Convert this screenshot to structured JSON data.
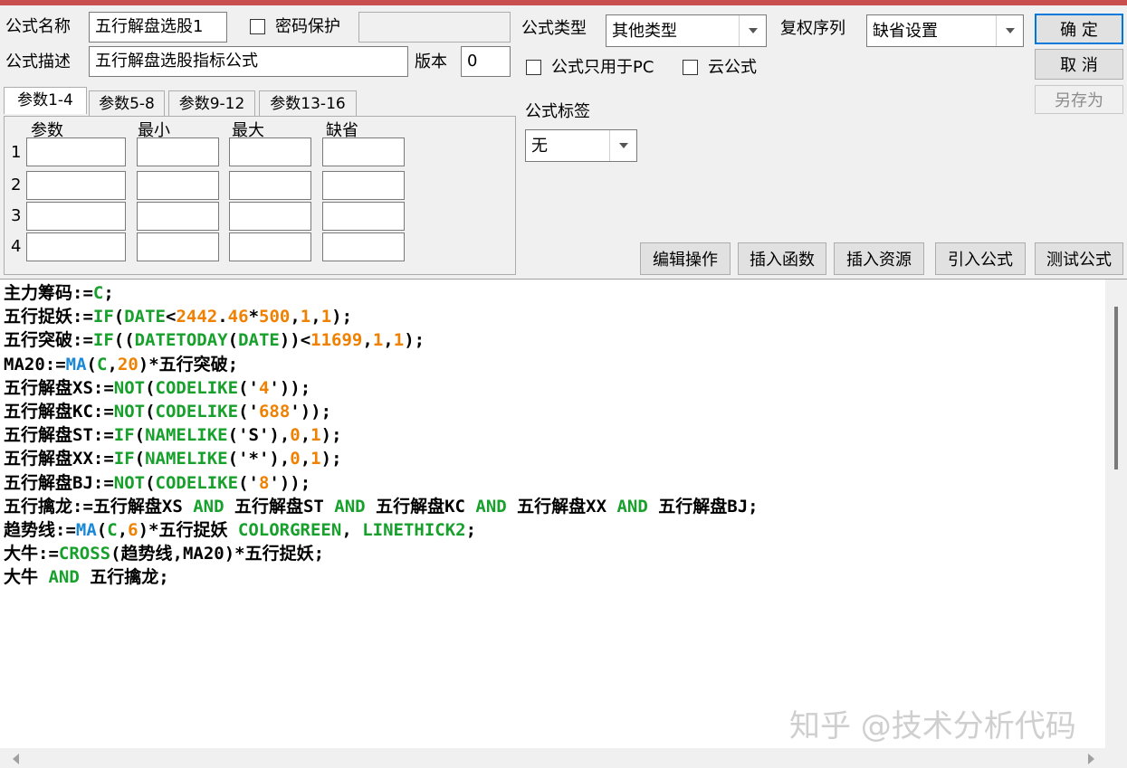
{
  "form": {
    "name_label": "公式名称",
    "name_value": "五行解盘选股1",
    "password_label": "密码保护",
    "password_value": "",
    "desc_label": "公式描述",
    "desc_value": "五行解盘选股指标公式",
    "version_label": "版本",
    "version_value": "0",
    "type_label": "公式类型",
    "type_value": "其他类型",
    "rights_label": "复权序列",
    "rights_value": "缺省设置",
    "pc_only_label": "公式只用于PC",
    "cloud_label": "云公式",
    "tag_label": "公式标签",
    "tag_value": "无"
  },
  "buttons": {
    "ok": "确  定",
    "cancel": "取  消",
    "save_as": "另存为",
    "edit_ops": "编辑操作",
    "insert_func": "插入函数",
    "insert_res": "插入资源",
    "import_formula": "引入公式",
    "test_formula": "测试公式"
  },
  "tabs": [
    "参数1-4",
    "参数5-8",
    "参数9-12",
    "参数13-16"
  ],
  "params": {
    "headers": [
      "参数",
      "最小",
      "最大",
      "缺省"
    ],
    "rows": [
      "1",
      "2",
      "3",
      "4"
    ]
  },
  "colors": {
    "keyword_green": "#18a02c",
    "number_orange": "#f08000",
    "func_blue": "#1a88d8",
    "title_red": "#c94f4f"
  },
  "code_lines": [
    [
      {
        "t": "主力筹码:=",
        "c": "k"
      },
      {
        "t": "C",
        "c": "g"
      },
      {
        "t": ";",
        "c": "k"
      }
    ],
    [
      {
        "t": "五行捉妖:=",
        "c": "k"
      },
      {
        "t": "IF",
        "c": "g"
      },
      {
        "t": "(",
        "c": "k"
      },
      {
        "t": "DATE",
        "c": "g"
      },
      {
        "t": "<",
        "c": "k"
      },
      {
        "t": "2442",
        "c": "o"
      },
      {
        "t": ".",
        "c": "k"
      },
      {
        "t": "46",
        "c": "o"
      },
      {
        "t": "*",
        "c": "k"
      },
      {
        "t": "500",
        "c": "o"
      },
      {
        "t": ",",
        "c": "k"
      },
      {
        "t": "1",
        "c": "o"
      },
      {
        "t": ",",
        "c": "k"
      },
      {
        "t": "1",
        "c": "o"
      },
      {
        "t": ");",
        "c": "k"
      }
    ],
    [
      {
        "t": "五行突破:=",
        "c": "k"
      },
      {
        "t": "IF",
        "c": "g"
      },
      {
        "t": "((",
        "c": "k"
      },
      {
        "t": "DATETODAY",
        "c": "g"
      },
      {
        "t": "(",
        "c": "k"
      },
      {
        "t": "DATE",
        "c": "g"
      },
      {
        "t": "))<",
        "c": "k"
      },
      {
        "t": "11699",
        "c": "o"
      },
      {
        "t": ",",
        "c": "k"
      },
      {
        "t": "1",
        "c": "o"
      },
      {
        "t": ",",
        "c": "k"
      },
      {
        "t": "1",
        "c": "o"
      },
      {
        "t": ");",
        "c": "k"
      }
    ],
    [
      {
        "t": "MA20:=",
        "c": "k"
      },
      {
        "t": "MA",
        "c": "b"
      },
      {
        "t": "(",
        "c": "k"
      },
      {
        "t": "C",
        "c": "g"
      },
      {
        "t": ",",
        "c": "k"
      },
      {
        "t": "20",
        "c": "o"
      },
      {
        "t": ")*五行突破;",
        "c": "k"
      }
    ],
    [
      {
        "t": "五行解盘XS:=",
        "c": "k"
      },
      {
        "t": "NOT",
        "c": "g"
      },
      {
        "t": "(",
        "c": "k"
      },
      {
        "t": "CODELIKE",
        "c": "g"
      },
      {
        "t": "('",
        "c": "k"
      },
      {
        "t": "4",
        "c": "o"
      },
      {
        "t": "'));",
        "c": "k"
      }
    ],
    [
      {
        "t": "五行解盘KC:=",
        "c": "k"
      },
      {
        "t": "NOT",
        "c": "g"
      },
      {
        "t": "(",
        "c": "k"
      },
      {
        "t": "CODELIKE",
        "c": "g"
      },
      {
        "t": "('",
        "c": "k"
      },
      {
        "t": "688",
        "c": "o"
      },
      {
        "t": "'));",
        "c": "k"
      }
    ],
    [
      {
        "t": "五行解盘ST:=",
        "c": "k"
      },
      {
        "t": "IF",
        "c": "g"
      },
      {
        "t": "(",
        "c": "k"
      },
      {
        "t": "NAMELIKE",
        "c": "g"
      },
      {
        "t": "('S'),",
        "c": "k"
      },
      {
        "t": "0",
        "c": "o"
      },
      {
        "t": ",",
        "c": "k"
      },
      {
        "t": "1",
        "c": "o"
      },
      {
        "t": ");",
        "c": "k"
      }
    ],
    [
      {
        "t": "五行解盘XX:=",
        "c": "k"
      },
      {
        "t": "IF",
        "c": "g"
      },
      {
        "t": "(",
        "c": "k"
      },
      {
        "t": "NAMELIKE",
        "c": "g"
      },
      {
        "t": "('*'),",
        "c": "k"
      },
      {
        "t": "0",
        "c": "o"
      },
      {
        "t": ",",
        "c": "k"
      },
      {
        "t": "1",
        "c": "o"
      },
      {
        "t": ");",
        "c": "k"
      }
    ],
    [
      {
        "t": "五行解盘BJ:=",
        "c": "k"
      },
      {
        "t": "NOT",
        "c": "g"
      },
      {
        "t": "(",
        "c": "k"
      },
      {
        "t": "CODELIKE",
        "c": "g"
      },
      {
        "t": "('",
        "c": "k"
      },
      {
        "t": "8",
        "c": "o"
      },
      {
        "t": "'));",
        "c": "k"
      }
    ],
    [
      {
        "t": "五行擒龙:=五行解盘XS ",
        "c": "k"
      },
      {
        "t": "AND",
        "c": "g"
      },
      {
        "t": " 五行解盘ST ",
        "c": "k"
      },
      {
        "t": "AND",
        "c": "g"
      },
      {
        "t": " 五行解盘KC ",
        "c": "k"
      },
      {
        "t": "AND",
        "c": "g"
      },
      {
        "t": " 五行解盘XX ",
        "c": "k"
      },
      {
        "t": "AND",
        "c": "g"
      },
      {
        "t": " 五行解盘BJ;",
        "c": "k"
      }
    ],
    [
      {
        "t": "趋势线:=",
        "c": "k"
      },
      {
        "t": "MA",
        "c": "b"
      },
      {
        "t": "(",
        "c": "k"
      },
      {
        "t": "C",
        "c": "g"
      },
      {
        "t": ",",
        "c": "k"
      },
      {
        "t": "6",
        "c": "o"
      },
      {
        "t": ")*五行捉妖 ",
        "c": "k"
      },
      {
        "t": "COLORGREEN",
        "c": "g"
      },
      {
        "t": ", ",
        "c": "k"
      },
      {
        "t": "LINETHICK2",
        "c": "g"
      },
      {
        "t": ";",
        "c": "k"
      }
    ],
    [
      {
        "t": "大牛:=",
        "c": "k"
      },
      {
        "t": "CROSS",
        "c": "g"
      },
      {
        "t": "(趋势线,MA20)*五行捉妖;",
        "c": "k"
      }
    ],
    [
      {
        "t": "大牛 ",
        "c": "k"
      },
      {
        "t": "AND",
        "c": "g"
      },
      {
        "t": " 五行擒龙;",
        "c": "k"
      }
    ]
  ],
  "watermark": "知乎 @技术分析代码"
}
